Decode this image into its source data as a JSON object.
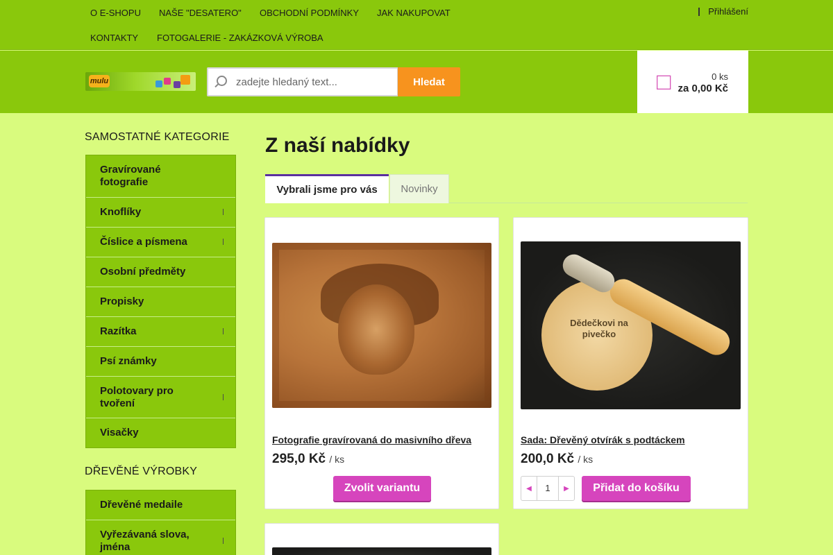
{
  "top_menu": {
    "items": [
      "O E-SHOPU",
      "NAŠE \"DESATERO\"",
      "OBCHODNÍ PODMÍNKY",
      "JAK NAKUPOVAT",
      "KONTAKTY",
      "FOTOGALERIE - ZAKÁZKOVÁ VÝROBA"
    ],
    "login": "Přihlášení"
  },
  "header": {
    "logo_text": "mulu",
    "search": {
      "placeholder": "zadejte hledaný text...",
      "button": "Hledat"
    },
    "cart": {
      "qty": "0 ks",
      "total": "za 0,00 Kč",
      "icon": "cart-icon"
    }
  },
  "sidebar": {
    "group1_title": "SAMOSTATNÉ KATEGORIE",
    "group1": [
      {
        "label": "Gravírované fotografie",
        "has_sub": false
      },
      {
        "label": "Knoflíky",
        "has_sub": true
      },
      {
        "label": "Číslice a písmena",
        "has_sub": true
      },
      {
        "label": "Osobní předměty",
        "has_sub": false
      },
      {
        "label": "Propisky",
        "has_sub": false
      },
      {
        "label": "Razítka",
        "has_sub": true
      },
      {
        "label": "Psí známky",
        "has_sub": false
      },
      {
        "label": "Polotovary pro tvoření",
        "has_sub": true
      },
      {
        "label": "Visačky",
        "has_sub": false
      }
    ],
    "group2_title": "DŘEVĚNÉ VÝROBKY",
    "group2": [
      {
        "label": "Dřevěné medaile",
        "has_sub": false
      },
      {
        "label": "Vyřezávaná slova, jména",
        "has_sub": true
      }
    ]
  },
  "main": {
    "title": "Z naší nabídky",
    "tabs": [
      "Vybrali jsme pro vás",
      "Novinky"
    ],
    "products": [
      {
        "name": "Fotografie gravírovaná do masivního dřeva",
        "price": "295,0 Kč",
        "unit": "/ ks",
        "button": "Zvolit variantu"
      },
      {
        "name": "Sada: Dřevěný otvírák s podtáckem",
        "price": "200,0 Kč",
        "unit": "/ ks",
        "button": "Přidat do košíku",
        "qty": "1",
        "engraving": "Dědečkovi na pivečko"
      }
    ]
  },
  "colors": {
    "nav": "#8ac80c",
    "page": "#d9fb7e",
    "accent": "#d645bd",
    "search_btn": "#f7931e",
    "tab_active": "#5a2fa0"
  }
}
